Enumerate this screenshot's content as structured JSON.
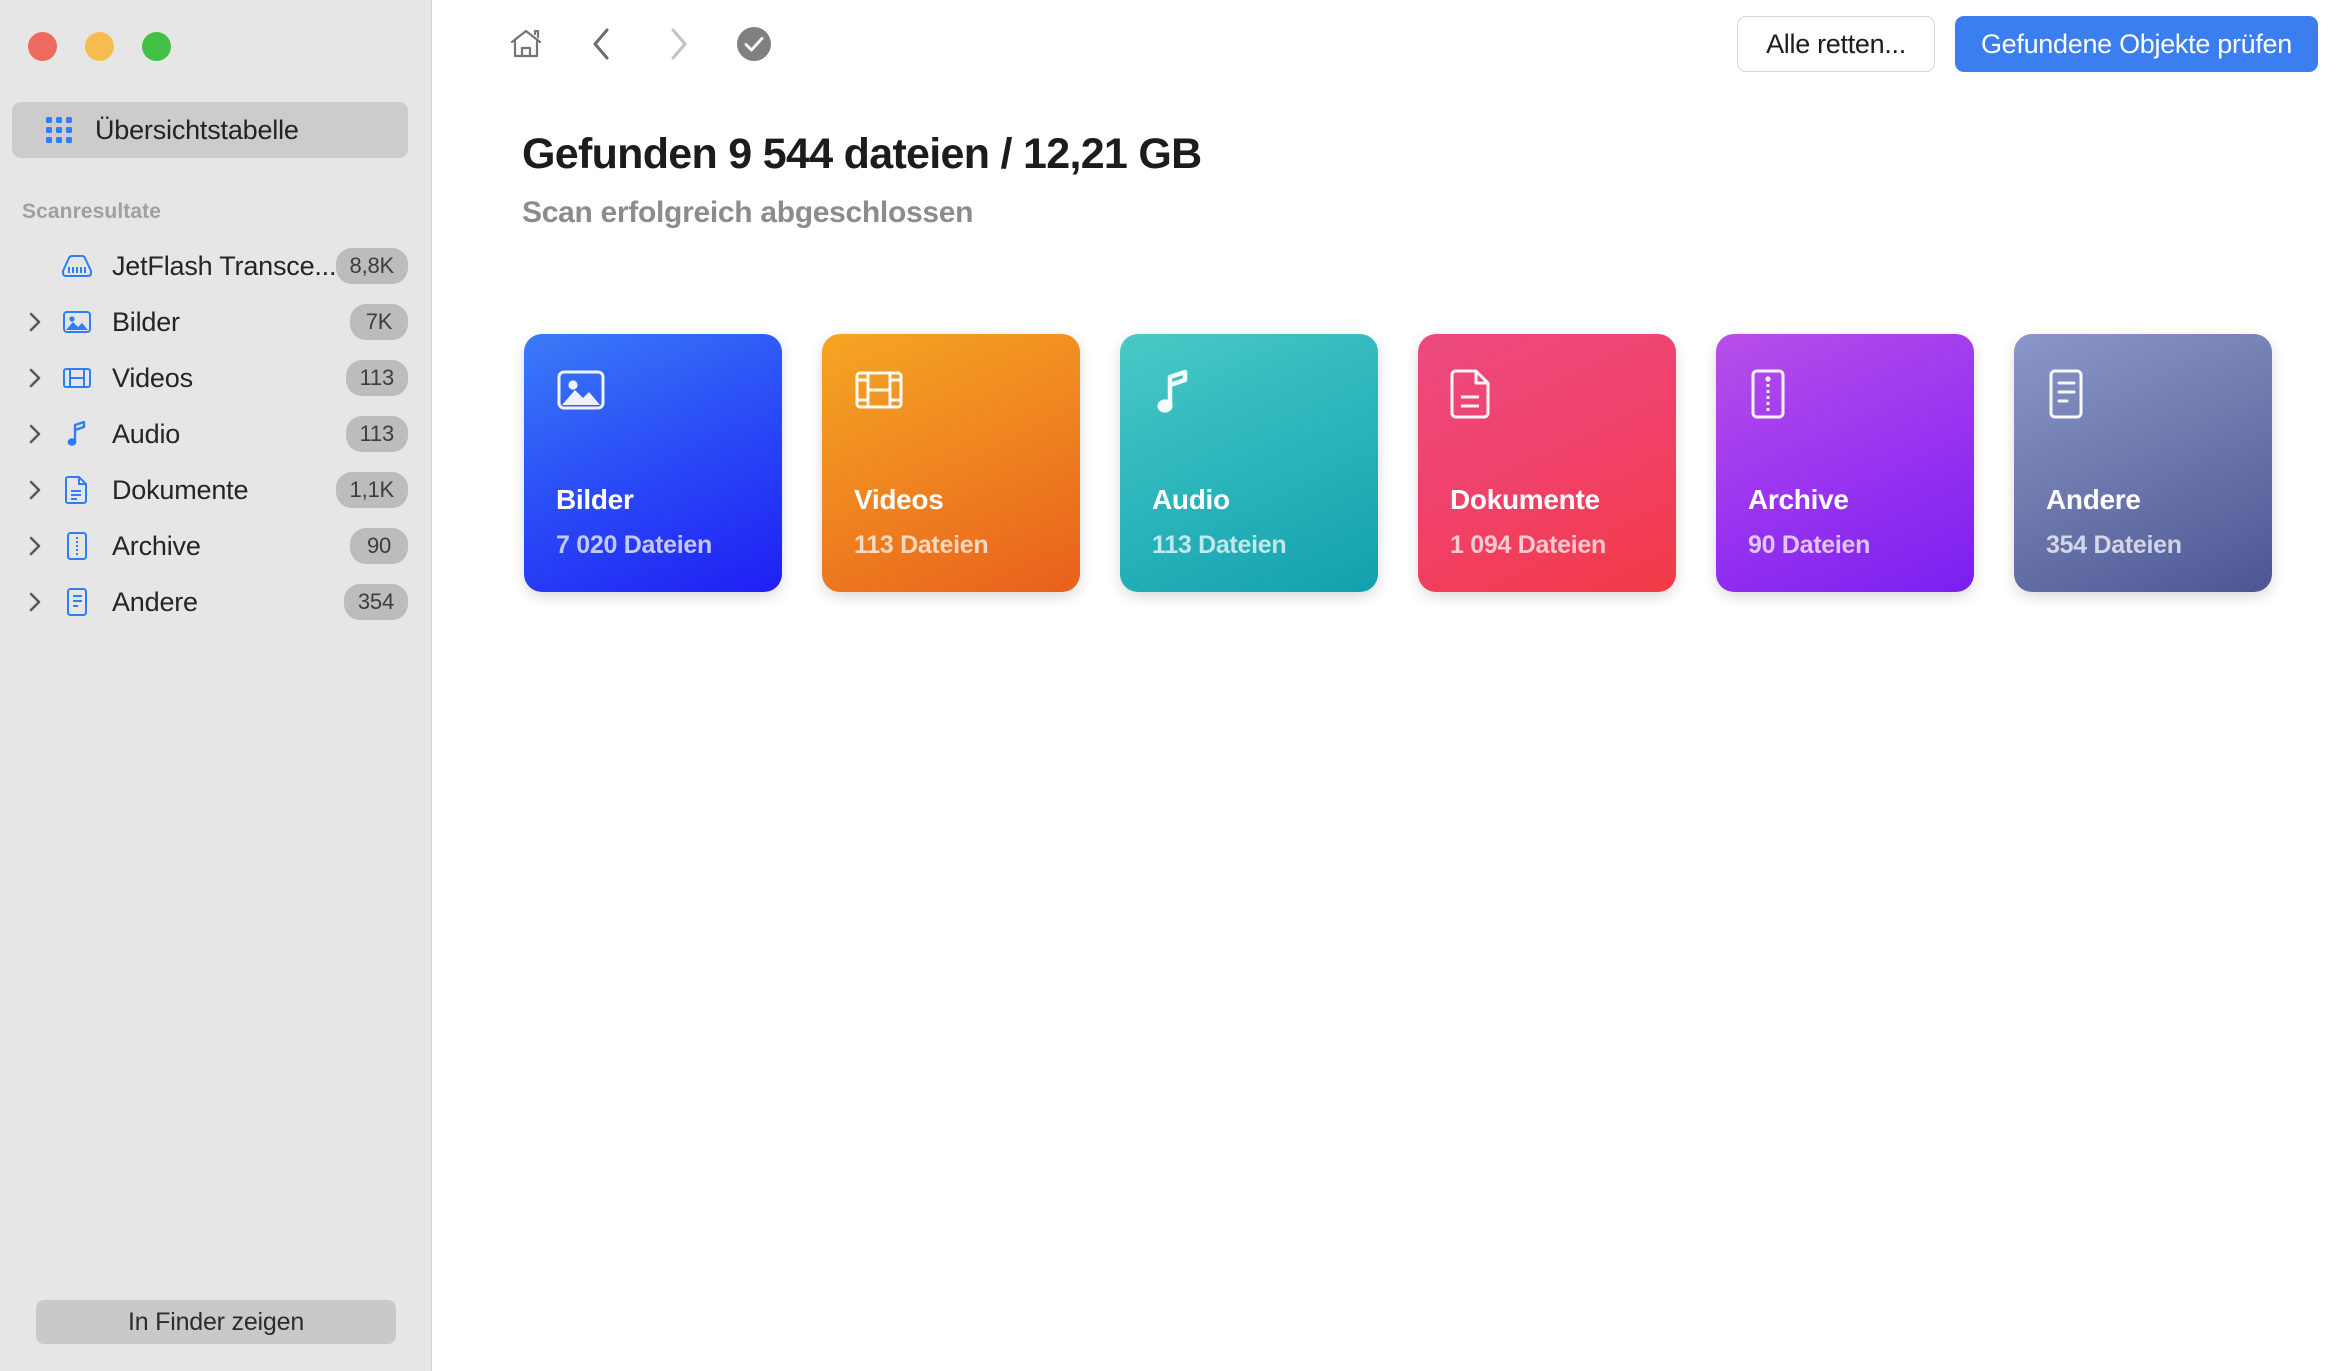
{
  "window": {
    "traffic_lights": [
      {
        "name": "close",
        "color": "#ed6a5e"
      },
      {
        "name": "minimize",
        "color": "#f5bd4f"
      },
      {
        "name": "zoom",
        "color": "#42c043"
      }
    ]
  },
  "sidebar": {
    "overview": {
      "label": "Übersichtstabelle",
      "icon": "grid-icon"
    },
    "section_title": "Scanresultate",
    "tree": [
      {
        "label": "JetFlash Transce...",
        "badge": "8,8K",
        "icon": "drive-icon",
        "has_twisty": false
      },
      {
        "label": "Bilder",
        "badge": "7K",
        "icon": "image-icon",
        "has_twisty": true
      },
      {
        "label": "Videos",
        "badge": "113",
        "icon": "film-icon",
        "has_twisty": true
      },
      {
        "label": "Audio",
        "badge": "113",
        "icon": "music-icon",
        "has_twisty": true
      },
      {
        "label": "Dokumente",
        "badge": "1,1K",
        "icon": "document-icon",
        "has_twisty": true
      },
      {
        "label": "Archive",
        "badge": "90",
        "icon": "archive-icon",
        "has_twisty": true
      },
      {
        "label": "Andere",
        "badge": "354",
        "icon": "other-icon",
        "has_twisty": true
      }
    ],
    "finder_button": "In Finder zeigen"
  },
  "toolbar": {
    "nav": [
      {
        "name": "home-icon",
        "state": "enabled"
      },
      {
        "name": "chevron-left-icon",
        "state": "enabled"
      },
      {
        "name": "chevron-right-icon",
        "state": "disabled"
      },
      {
        "name": "check-circle-icon",
        "state": "enabled"
      }
    ],
    "save_all_label": "Alle retten...",
    "review_label": "Gefundene Objekte prüfen",
    "primary_color": "#3b7ef0"
  },
  "main": {
    "headline": "Gefunden 9 544 dateien / 12,21 GB",
    "subhead": "Scan erfolgreich abgeschlossen",
    "cards": [
      {
        "title": "Bilder",
        "count": "7 020 Dateien",
        "icon": "image-icon",
        "from": "#3a7cf7",
        "to": "#1f1ff4"
      },
      {
        "title": "Videos",
        "count": "113 Dateien",
        "icon": "film-icon",
        "from": "#f5a623",
        "to": "#e8601c"
      },
      {
        "title": "Audio",
        "count": "113 Dateien",
        "icon": "music-icon",
        "from": "#49c9c6",
        "to": "#13a0ae"
      },
      {
        "title": "Dokumente",
        "count": "1 094 Dateien",
        "icon": "document-icon",
        "from": "#ec4a7f",
        "to": "#f33a46"
      },
      {
        "title": "Archive",
        "count": "90 Dateien",
        "icon": "archive-icon",
        "from": "#b martí",
        "to": "#7a1ff0"
      },
      {
        "title": "Andere",
        "count": "354 Dateien",
        "icon": "other-icon",
        "from": "#8693c4",
        "to": "#4d5694"
      }
    ]
  }
}
